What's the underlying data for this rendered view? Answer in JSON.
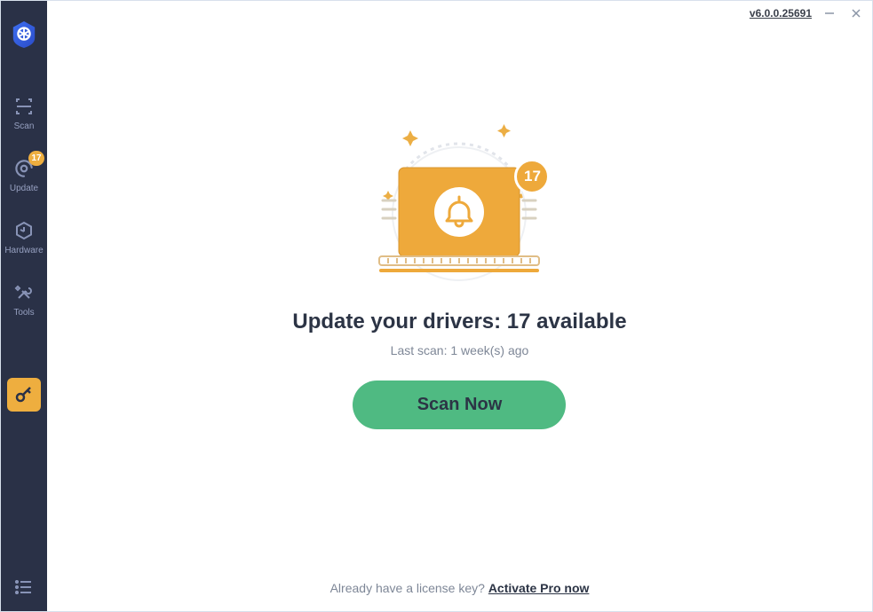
{
  "titlebar": {
    "version": "v6.0.0.25691"
  },
  "sidebar": {
    "scan": "Scan",
    "update": "Update",
    "update_badge": "17",
    "hardware": "Hardware",
    "tools": "Tools"
  },
  "hero": {
    "badge": "17",
    "heading": "Update your drivers: 17 available",
    "subtext": "Last scan: 1 week(s) ago",
    "scan_button": "Scan Now"
  },
  "footer": {
    "prompt": "Already have a license key? ",
    "link": "Activate Pro now"
  }
}
